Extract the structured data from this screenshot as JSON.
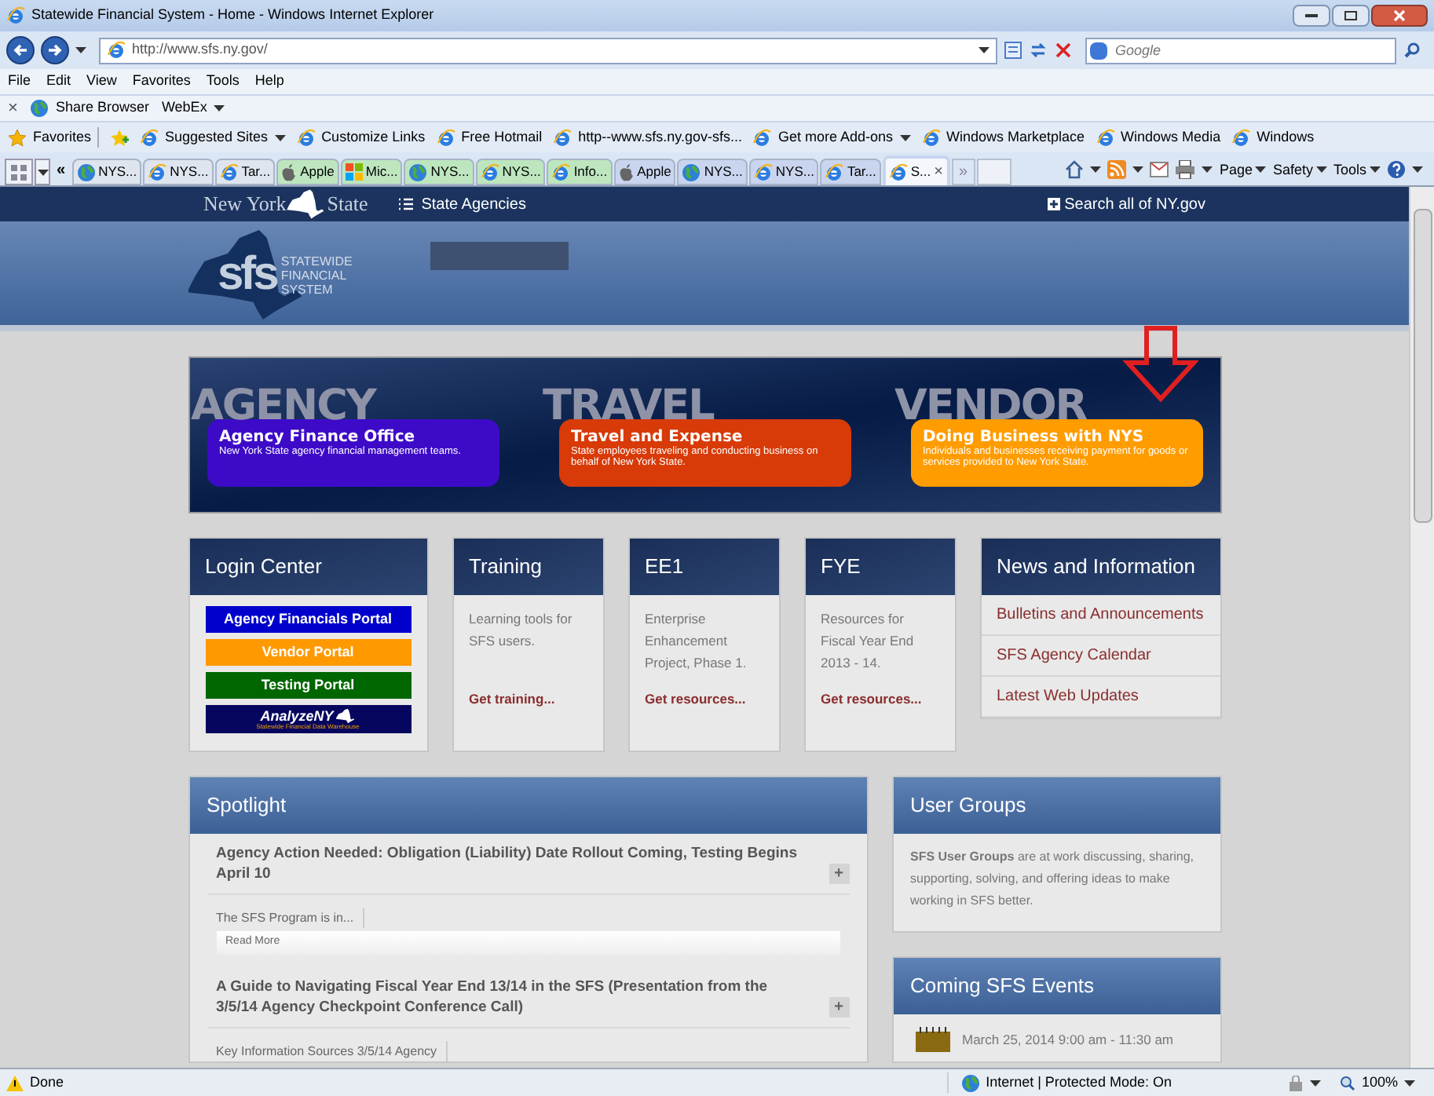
{
  "window": {
    "title": "Statewide Financial System - Home - Windows Internet Explorer"
  },
  "address_bar": {
    "url": "http://www.sfs.ny.gov/",
    "search_placeholder": "Google"
  },
  "menu": [
    "File",
    "Edit",
    "View",
    "Favorites",
    "Tools",
    "Help"
  ],
  "webex_bar": {
    "close": "×",
    "items": [
      {
        "label": "Share Browser",
        "kind": "globe"
      },
      {
        "label": "WebEx",
        "kind": "dropdown"
      }
    ]
  },
  "favorites_bar": {
    "label": "Favorites",
    "items": [
      {
        "label": "Suggested Sites",
        "dropdown": true
      },
      {
        "label": "Customize Links",
        "dropdown": false
      },
      {
        "label": "Free Hotmail",
        "dropdown": false
      },
      {
        "label": "http--www.sfs.ny.gov-sfs...",
        "dropdown": false
      },
      {
        "label": "Get more Add-ons",
        "dropdown": true
      },
      {
        "label": "Windows Marketplace",
        "dropdown": false
      },
      {
        "label": "Windows Media",
        "dropdown": false
      },
      {
        "label": "Windows",
        "dropdown": false
      }
    ]
  },
  "tab_row": {
    "scroll_left": "«",
    "scroll_right": "»",
    "tabs": [
      {
        "label": "NYS...",
        "kind": "globe",
        "color": "#dfe5ee",
        "selected": false
      },
      {
        "label": "NYS...",
        "kind": "ie",
        "color": "#dfe5ee",
        "selected": false
      },
      {
        "label": "Tar...",
        "kind": "ie",
        "color": "#dfe5ee",
        "selected": false
      },
      {
        "label": "Apple",
        "kind": "apple",
        "color": "#bde6be",
        "selected": false
      },
      {
        "label": "Mic...",
        "kind": "windows",
        "color": "#bde6be",
        "selected": false
      },
      {
        "label": "NYS...",
        "kind": "globe",
        "color": "#bde6be",
        "selected": false
      },
      {
        "label": "NYS...",
        "kind": "ie",
        "color": "#bde6be",
        "selected": false
      },
      {
        "label": "Info...",
        "kind": "ie",
        "color": "#bde6be",
        "selected": false
      },
      {
        "label": "Apple",
        "kind": "apple",
        "color": "#c9d5ef",
        "selected": false
      },
      {
        "label": "NYS...",
        "kind": "globe",
        "color": "#c9d5ef",
        "selected": false
      },
      {
        "label": "NYS...",
        "kind": "ie",
        "color": "#c9d5ef",
        "selected": false
      },
      {
        "label": "Tar...",
        "kind": "ie",
        "color": "#c9d5ef",
        "selected": false
      },
      {
        "label": "S...",
        "kind": "ie",
        "color": "#c9d5ef",
        "selected": true
      }
    ],
    "close": "×"
  },
  "command_bar": [
    "Page",
    "Safety",
    "Tools"
  ],
  "site_nav": {
    "brand_left": "New York",
    "brand_right": "State",
    "agencies": "State Agencies",
    "search": "Search all of NY.gov"
  },
  "logo": {
    "mark": "sfs",
    "lines": [
      "STATEWIDE",
      "FINANCIAL",
      "SYSTEM"
    ]
  },
  "banners": [
    {
      "word": "AGENCY",
      "title": "Agency Finance Office",
      "text": "New York State agency financial management teams.",
      "color": "#3d0bc8"
    },
    {
      "word": "TRAVEL",
      "title": "Travel and Expense",
      "text": "State employees traveling and conducting business on behalf of New York State.",
      "color": "#d83a08"
    },
    {
      "word": "VENDOR",
      "title": "Doing Business with NYS",
      "text": "Individuals and businesses receiving payment for goods or services provided to New York State.",
      "color": "#ff9c00"
    }
  ],
  "login_center": {
    "title": "Login Center",
    "portals": [
      {
        "label": "Agency Financials Portal",
        "color": "#0000cc"
      },
      {
        "label": "Vendor Portal",
        "color": "#ff9900"
      },
      {
        "label": "Testing Portal",
        "color": "#006600"
      }
    ],
    "analyze": {
      "name": "AnalyzeNY",
      "tagline": "Statewide Financial Data Warehouse"
    }
  },
  "cards": [
    {
      "title": "Training",
      "text": "Learning tools for SFS users.",
      "link": "Get training..."
    },
    {
      "title": "EE1",
      "text": "Enterprise Enhancement Project, Phase 1.",
      "link": "Get resources..."
    },
    {
      "title": "FYE",
      "text": "Resources for Fiscal Year End 2013 - 14.",
      "link": "Get resources..."
    }
  ],
  "news": {
    "title": "News and Information",
    "links": [
      "Bulletins and Announcements",
      "SFS Agency Calendar",
      "Latest Web Updates"
    ]
  },
  "spotlight": {
    "title": "Spotlight",
    "expand": "+",
    "items": [
      {
        "title": "Agency Action Needed: Obligation (Liability) Date Rollout Coming, Testing Begins April 10",
        "excerpt": "The SFS Program is in...",
        "more": "Read More"
      },
      {
        "title": "A Guide to Navigating Fiscal Year End 13/14 in the SFS (Presentation from the 3/5/14 Agency Checkpoint Conference Call)",
        "excerpt": "Key Information Sources 3/5/14 Agency"
      }
    ]
  },
  "user_groups": {
    "title": "User Groups",
    "text": "**SFS User Groups** are at work discussing, sharing, supporting, solving, and offering ideas to make working in SFS better."
  },
  "events": {
    "title": "Coming SFS Events",
    "items": [
      "March 25, 2014 9:00 am - 11:30 am"
    ]
  },
  "status_bar": {
    "status": "Done",
    "zone": "Internet | Protected Mode: On",
    "zoom": "100%"
  }
}
